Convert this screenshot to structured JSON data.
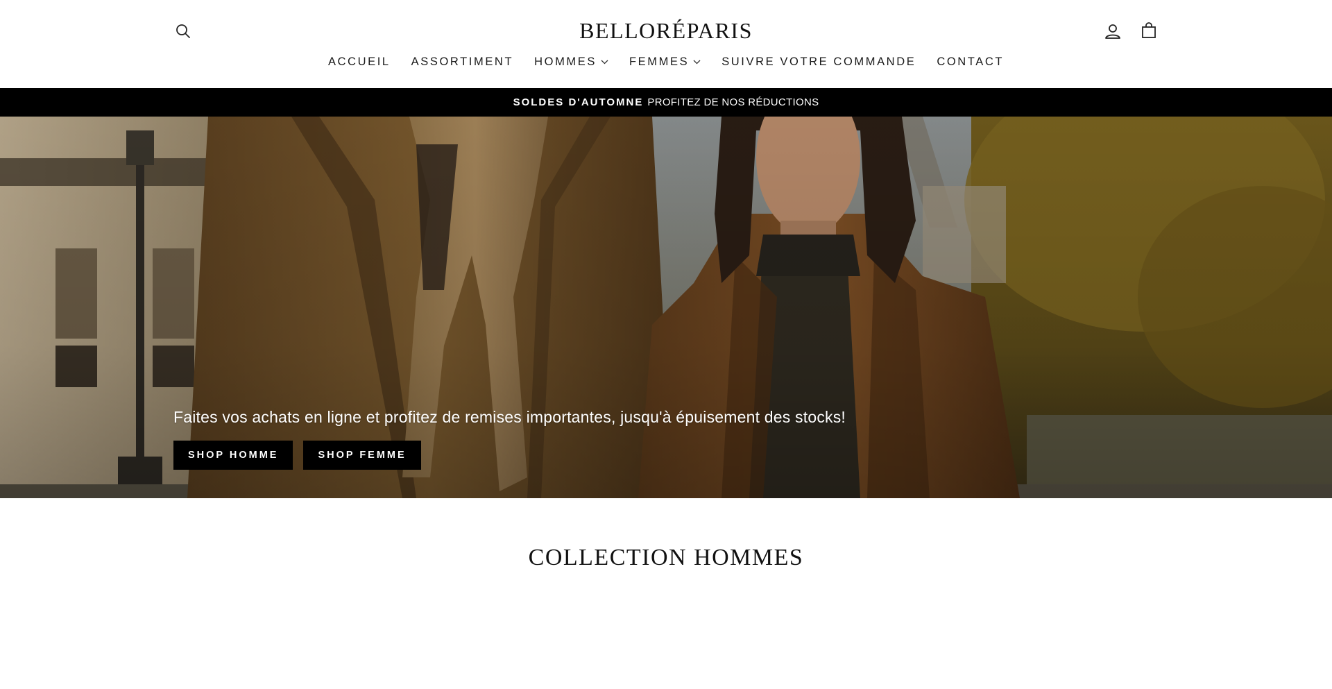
{
  "header": {
    "logo": "BELLORÉPARIS",
    "icons": {
      "search": "search-icon",
      "account": "user-icon",
      "cart": "shopping-bag-icon"
    }
  },
  "nav": {
    "items": [
      {
        "label": "ACCUEIL",
        "has_dropdown": false
      },
      {
        "label": "ASSORTIMENT",
        "has_dropdown": false
      },
      {
        "label": "HOMMES",
        "has_dropdown": true
      },
      {
        "label": "FEMMES",
        "has_dropdown": true
      },
      {
        "label": "SUIVRE VOTRE COMMANDE",
        "has_dropdown": false
      },
      {
        "label": "CONTACT",
        "has_dropdown": false
      }
    ]
  },
  "announcement": {
    "bold": "SOLDES D'AUTOMNE",
    "text": "PROFITEZ DE NOS RÉDUCTIONS",
    "background": "#000000",
    "color": "#ffffff"
  },
  "hero": {
    "text": "Faites vos achats en ligne et profitez de remises importantes, jusqu'à épuisement des stocks!",
    "buttons": [
      {
        "label": "SHOP HOMME"
      },
      {
        "label": "SHOP FEMME"
      }
    ]
  },
  "collection": {
    "title": "COLLECTION HOMMES"
  }
}
